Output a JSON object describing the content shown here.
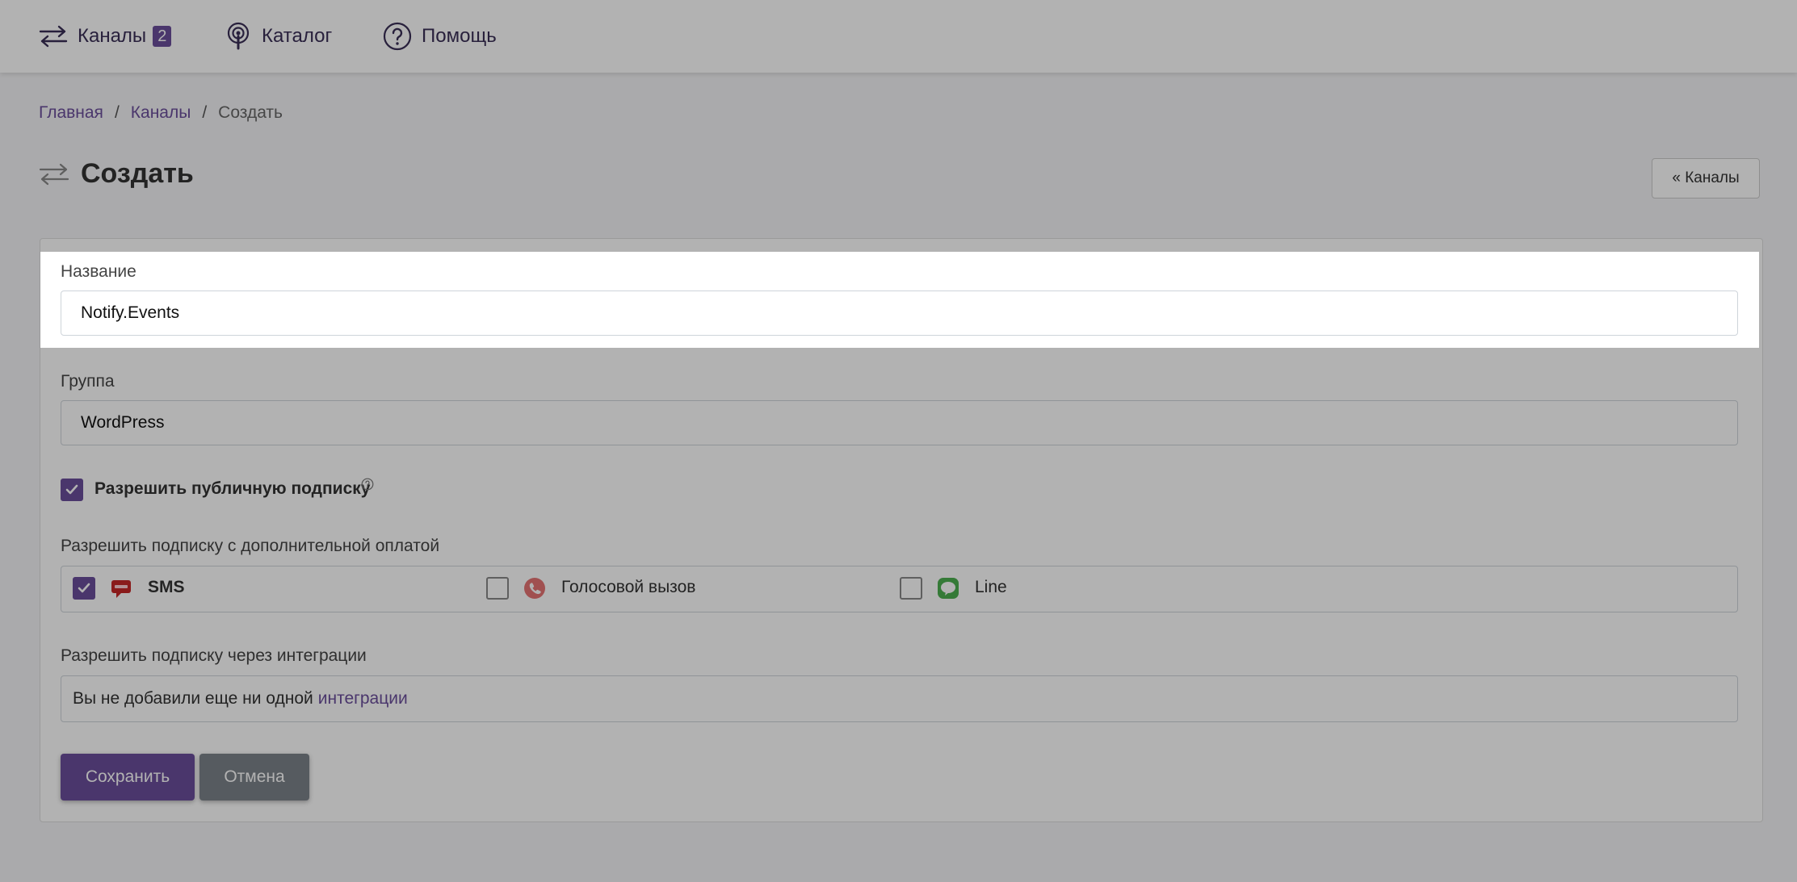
{
  "nav": {
    "channels_label": "Каналы",
    "channels_badge": "2",
    "catalog_label": "Каталог",
    "help_label": "Помощь"
  },
  "breadcrumb": {
    "home": "Главная",
    "channels": "Каналы",
    "current": "Создать",
    "separator": "/"
  },
  "page": {
    "title": "Создать",
    "back_button": "« Каналы"
  },
  "form": {
    "name_label": "Название",
    "name_value": "Notify.Events",
    "group_label": "Группа",
    "group_value": "WordPress",
    "public_subscription_label": "Разрешить публичную подписку",
    "public_subscription_checked": true,
    "paid_subscription_label": "Разрешить подписку с дополнительной оплатой",
    "paid_options": [
      {
        "label": "SMS",
        "checked": true,
        "icon": "sms-icon",
        "color": "#c62828"
      },
      {
        "label": "Голосовой вызов",
        "checked": false,
        "icon": "phone-call-icon",
        "color": "#e57373"
      },
      {
        "label": "Line",
        "checked": false,
        "icon": "line-icon",
        "color": "#4caf50"
      }
    ],
    "integrations_label": "Разрешить подписку через интеграции",
    "integrations_text": "Вы не добавили еще ни одной",
    "integrations_link": "интеграции",
    "save_label": "Сохранить",
    "cancel_label": "Отмена"
  },
  "colors": {
    "accent": "#6b4e9b",
    "cancel": "#7c838a"
  }
}
